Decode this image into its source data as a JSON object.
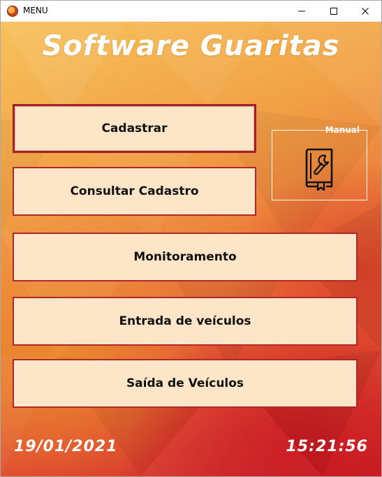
{
  "window": {
    "title": "MENU",
    "icon": "app-logo-icon",
    "controls": [
      "minimize-icon",
      "maximize-icon",
      "close-icon"
    ]
  },
  "header": {
    "title": "Software Guaritas"
  },
  "menu": {
    "buttons": [
      {
        "label": "Cadastrar"
      },
      {
        "label": "Consultar Cadastro"
      },
      {
        "label": "Monitoramento"
      },
      {
        "label": "Entrada de veículos"
      },
      {
        "label": "Saída de Veículos"
      }
    ]
  },
  "manual": {
    "label": "Manual",
    "icon": "manual-book-wrench-icon"
  },
  "footer": {
    "date": "19/01/2021",
    "time": "15:21:56"
  },
  "colors": {
    "button_bg": "#fde6c8",
    "button_border": "#b0282a",
    "gradient_top": "#f7c15a",
    "gradient_bottom": "#c81e28",
    "text_light": "#ffffff"
  }
}
